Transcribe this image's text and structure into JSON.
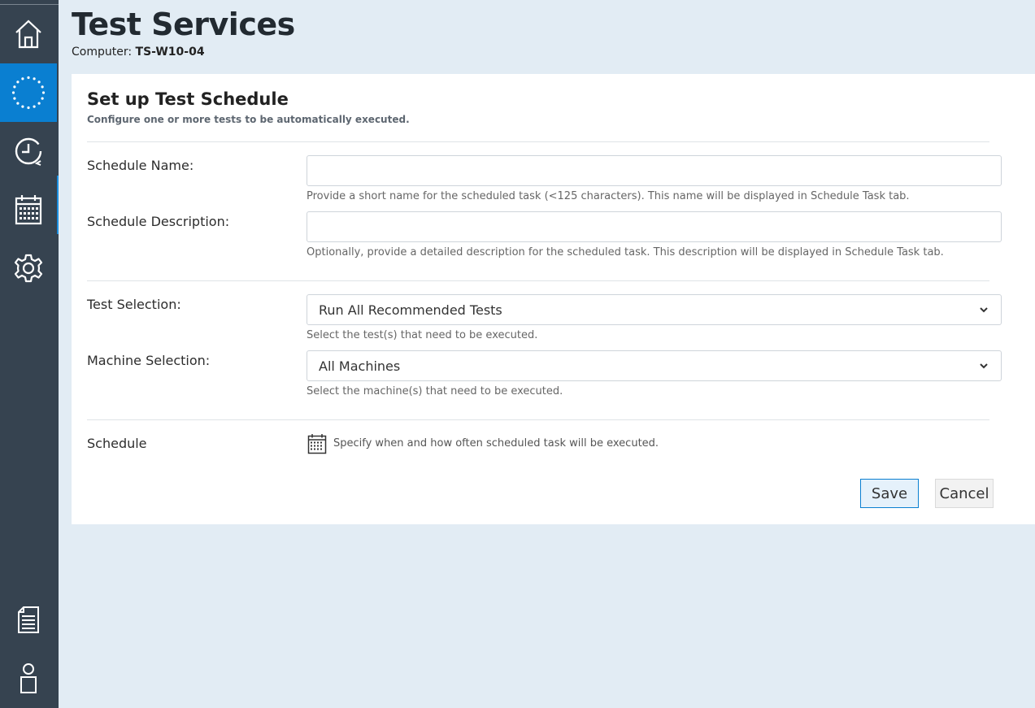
{
  "header": {
    "title": "Test Services",
    "computer_label": "Computer:",
    "computer_name": "TS-W10-04"
  },
  "sidebar": {
    "items": [
      {
        "icon": "home-icon",
        "active": false
      },
      {
        "icon": "spinner-icon",
        "active": true
      },
      {
        "icon": "history-clock-icon",
        "active": false
      },
      {
        "icon": "calendar-icon",
        "active": false
      },
      {
        "icon": "gear-icon",
        "active": false
      },
      {
        "icon": "document-icon",
        "active": false
      },
      {
        "icon": "user-icon",
        "active": false
      }
    ]
  },
  "form": {
    "title": "Set up Test Schedule",
    "subtitle": "Configure one or more tests to be automatically executed.",
    "schedule_name": {
      "label": "Schedule Name:",
      "value": "",
      "help": "Provide a short name for the scheduled task (<125 characters). This name will be displayed in Schedule Task tab."
    },
    "schedule_description": {
      "label": "Schedule Description:",
      "value": "",
      "help": "Optionally, provide a detailed description for the scheduled task. This description will be displayed in Schedule Task tab."
    },
    "test_selection": {
      "label": "Test Selection:",
      "value": "Run All Recommended Tests",
      "help": "Select the test(s) that need to be executed."
    },
    "machine_selection": {
      "label": "Machine Selection:",
      "value": "All Machines",
      "help": "Select the machine(s) that need to be executed."
    },
    "schedule": {
      "label": "Schedule",
      "help": "Specify when and how often scheduled task will be executed."
    },
    "save_label": "Save",
    "cancel_label": "Cancel"
  },
  "colors": {
    "sidebar_bg": "#364350",
    "active_nav": "#0a7fd1",
    "page_bg": "#e2ecf4",
    "card_bg": "#ffffff"
  }
}
